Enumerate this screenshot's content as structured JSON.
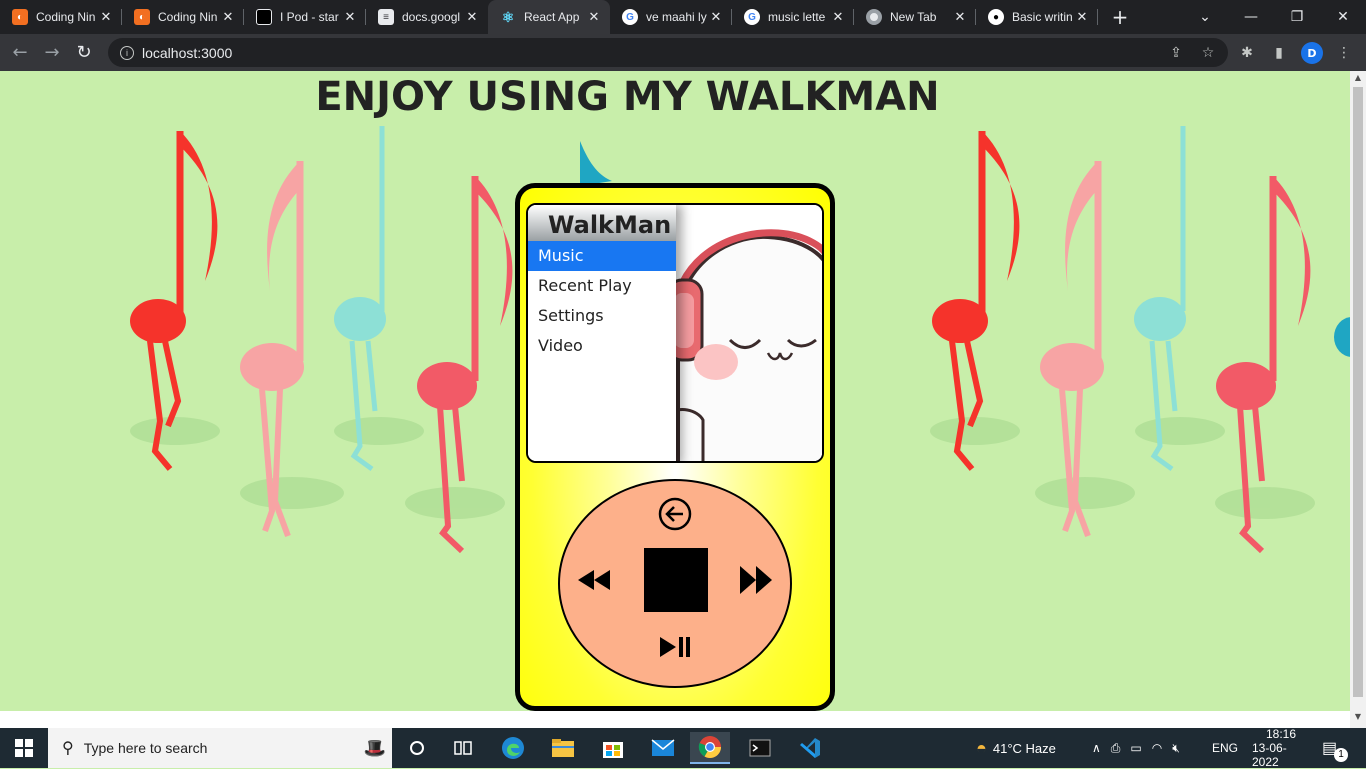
{
  "browser": {
    "tabs": [
      {
        "title": "Coding Nin",
        "icon": "coding-ninjas-icon",
        "color": "#f26f21"
      },
      {
        "title": "Coding Nin",
        "icon": "coding-ninjas-icon",
        "color": "#f26f21"
      },
      {
        "title": "I Pod - star",
        "icon": "codesandbox-icon",
        "color": "#000000"
      },
      {
        "title": "docs.googl",
        "icon": "docs-icon",
        "color": "#ffffff"
      },
      {
        "title": "React App",
        "icon": "react-icon",
        "color": "#61dafb"
      },
      {
        "title": "ve maahi ly",
        "icon": "google-icon",
        "color": "#4285f4"
      },
      {
        "title": "music lette",
        "icon": "google-icon",
        "color": "#4285f4"
      },
      {
        "title": "New Tab",
        "icon": "chrome-icon",
        "color": "#e8eaed"
      },
      {
        "title": "Basic writin",
        "icon": "github-icon",
        "color": "#ffffff"
      }
    ],
    "active_tab": 4,
    "new_tab_label": "+",
    "url": "localhost:3000",
    "profile_initial": "D"
  },
  "page": {
    "title": "ENJOY USING MY WALKMAN"
  },
  "walkman": {
    "menu_title": "WalkMan",
    "menu_items": [
      "Music",
      "Recent Play",
      "Settings",
      "Video"
    ],
    "selected_index": 0
  },
  "taskbar": {
    "search_placeholder": "Type here to search",
    "weather": "41°C  Haze",
    "language": "ENG",
    "time": "18:16",
    "date": "13-06-2022",
    "notification_count": "1"
  },
  "colors": {
    "page_bg": "#c8eeaa",
    "walkman_body": "#ffff00",
    "wheel": "#fdb08a",
    "menu_selected": "#1877f2"
  }
}
